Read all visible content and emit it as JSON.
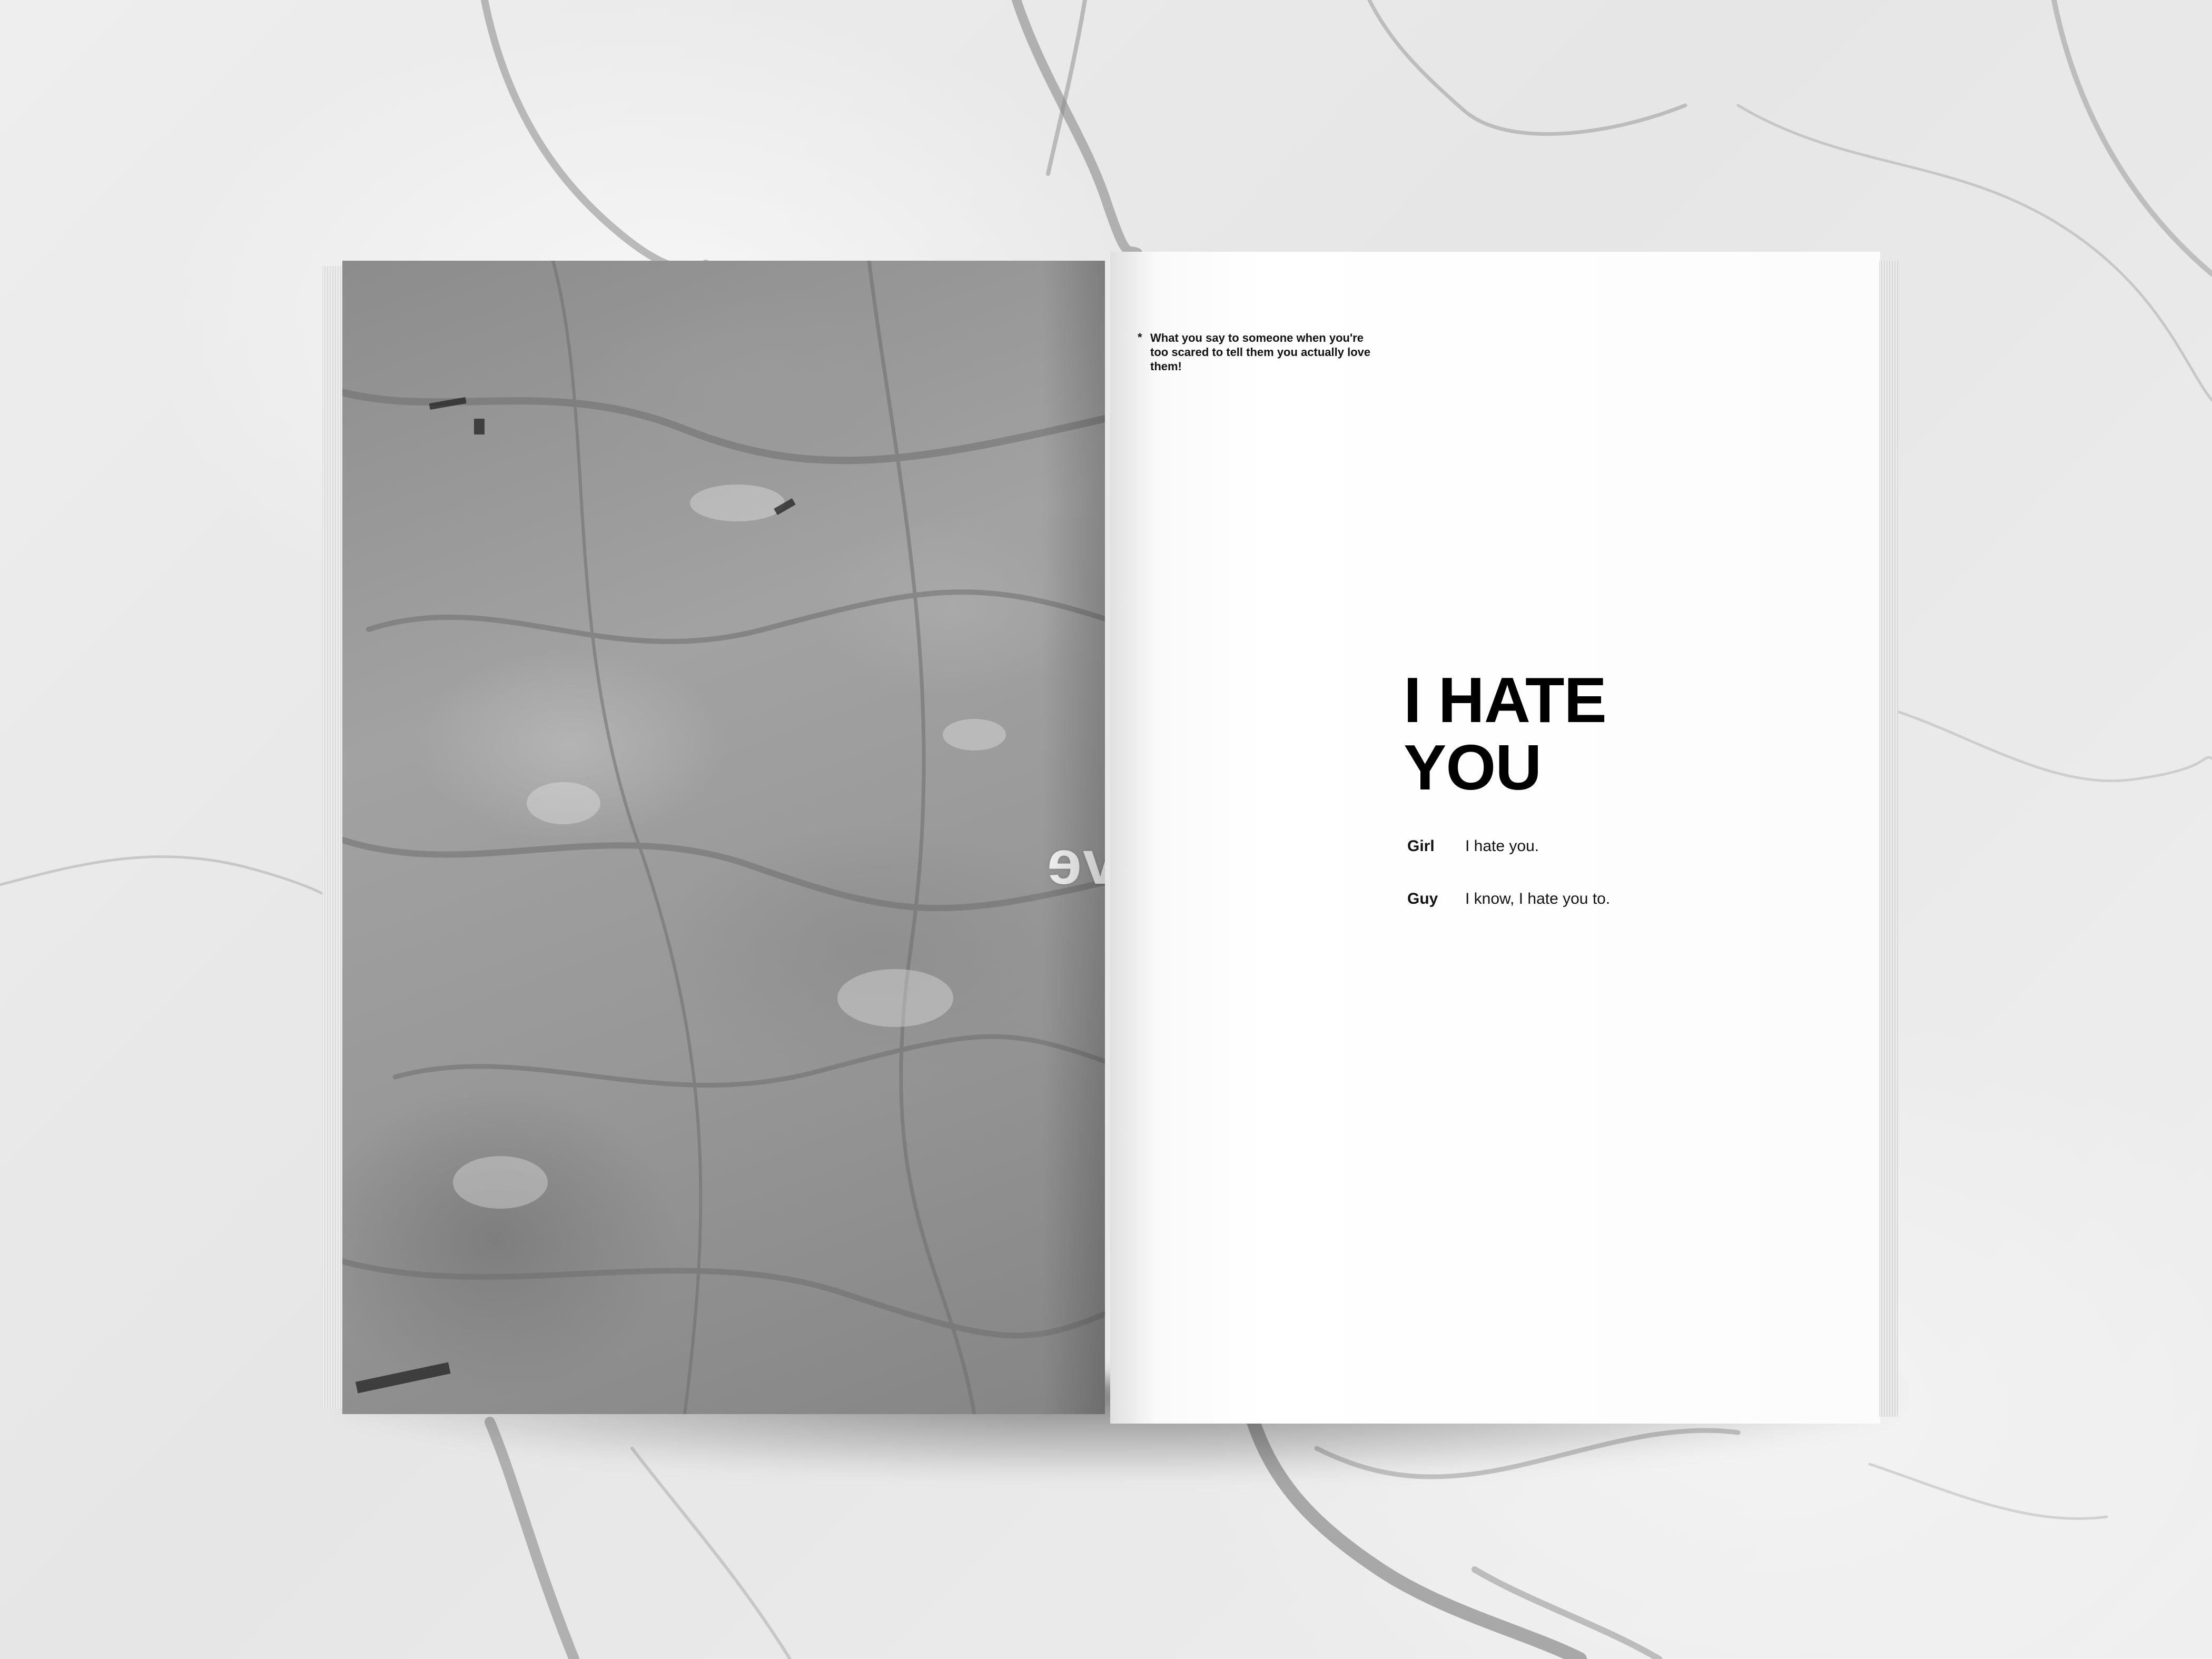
{
  "left_page": {
    "mirrored_title": "I'm in Love"
  },
  "right_page": {
    "footnote": {
      "mark": "*",
      "text": "What you say to someone when you're too scared to tell them you actually love them!"
    },
    "headline": [
      "I HATE",
      "YOU"
    ],
    "dialogue": [
      {
        "speaker": "Girl",
        "line": "I hate you."
      },
      {
        "speaker": "Guy",
        "line": "I know, I hate you to."
      }
    ]
  }
}
